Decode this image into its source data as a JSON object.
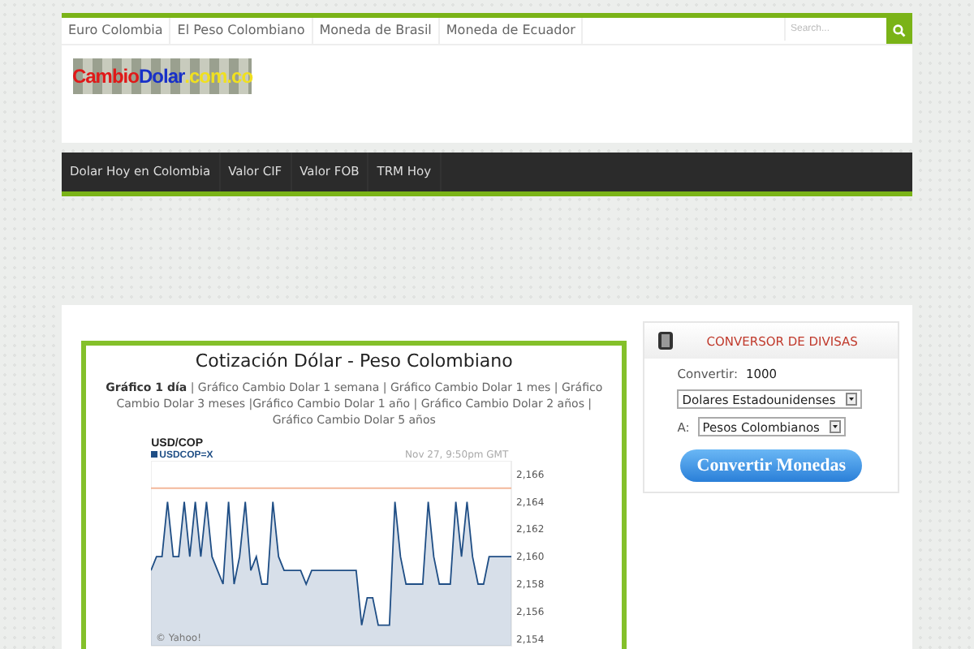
{
  "top_nav": {
    "items": [
      {
        "label": "Euro Colombia"
      },
      {
        "label": "El Peso Colombiano"
      },
      {
        "label": "Moneda de Brasil"
      },
      {
        "label": "Moneda de Ecuador"
      }
    ],
    "search": {
      "placeholder": "Search..."
    }
  },
  "logo": {
    "parts": [
      {
        "text": "Cambio",
        "color": "#e01818"
      },
      {
        "text": "Dolar",
        "color": "#1830c8"
      },
      {
        "text": ".com.co",
        "color": "#f0e020"
      }
    ]
  },
  "main_nav": {
    "items": [
      {
        "label": "Dolar Hoy en Colombia"
      },
      {
        "label": "Valor CIF"
      },
      {
        "label": "Valor FOB"
      },
      {
        "label": "TRM Hoy"
      }
    ]
  },
  "article": {
    "title": "Cotización Dólar - Peso Colombiano",
    "links": "**Gráfico 1 día** | Gráfico Cambio Dolar 1 semana | Gráfico Cambio Dolar 1 mes | Gráfico Cambio Dolar 3 meses |Gráfico Cambio Dolar 1 año | Gráfico Cambio Dolar 2 años | Gráfico Cambio Dolar 5 años",
    "chart": {
      "heading": "USD/COP",
      "timestamp": "Nov 27, 9:50pm GMT",
      "credit": "© Yahoo!",
      "chart_data": {
        "type": "area",
        "ylim": [
          2153.5,
          2167
        ],
        "ref_lines": [
          {
            "axis": "y",
            "value": 2165,
            "color": "#f3b79a"
          }
        ],
        "yticks": [
          {
            "value": 2166,
            "label": "2,166"
          },
          {
            "value": 2164,
            "label": "2,164"
          },
          {
            "value": 2162,
            "label": "2,162"
          },
          {
            "value": 2160,
            "label": "2,160"
          },
          {
            "value": 2158,
            "label": "2,158"
          },
          {
            "value": 2156,
            "label": "2,156"
          },
          {
            "value": 2154,
            "label": "2,154"
          }
        ],
        "series": [
          {
            "name": "USDCOP=X",
            "color": "#1f4e85",
            "values": [
              2159,
              2160,
              2160,
              2164,
              2160,
              2160,
              2164,
              2160,
              2164,
              2160,
              2164,
              2160,
              2159,
              2158,
              2164,
              2158,
              2160,
              2164,
              2159,
              2160,
              2158,
              2158,
              2164,
              2160,
              2159,
              2159,
              2159,
              2159,
              2158,
              2159,
              2159,
              2159,
              2159,
              2159,
              2159,
              2159,
              2159,
              2159,
              2155,
              2157,
              2157,
              2155,
              2155,
              2155,
              2164,
              2160,
              2158,
              2158,
              2158,
              2158,
              2164,
              2160,
              2158,
              2158,
              2158,
              2164,
              2160,
              2164,
              2160,
              2158,
              2158,
              2160,
              2160,
              2160,
              2160,
              2160
            ]
          }
        ]
      }
    }
  },
  "converter": {
    "title": "CONVERSOR DE DIVISAS",
    "amount_label": "Convertir:",
    "amount": "1000",
    "from": "Dolares Estadounidenses",
    "to_label": "A:",
    "to": "Pesos Colombianos",
    "button": "Convertir Monedas"
  }
}
